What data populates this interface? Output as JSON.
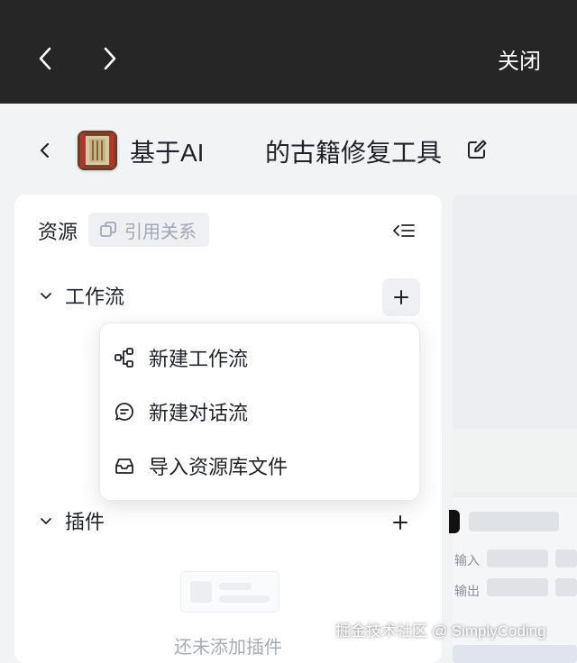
{
  "window": {
    "close_label": "关闭"
  },
  "header": {
    "title_part1": "基于AI",
    "title_part2": "的古籍修复工具"
  },
  "resources": {
    "title": "资源",
    "reference_label": "引用关系",
    "sections": {
      "workflow": "工作流",
      "plugin": "插件"
    },
    "empty_plugin_text": "还未添加插件"
  },
  "add_menu": {
    "items": [
      {
        "label": "新建工作流",
        "icon": "workflow-icon"
      },
      {
        "label": "新建对话流",
        "icon": "chat-icon"
      },
      {
        "label": "导入资源库文件",
        "icon": "inbox-icon"
      }
    ]
  },
  "right_panel": {
    "input_label": "输入",
    "output_label": "输出"
  },
  "watermark": "掘金技术社区 @ SimplyCoding"
}
